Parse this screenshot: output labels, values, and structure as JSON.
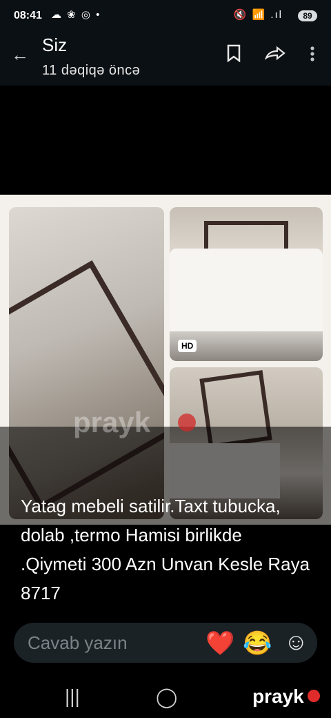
{
  "status_bar": {
    "time": "08:41",
    "left_icons": "☁ ❀ ◎ •",
    "right_icons": "🔇 📶 .ıl",
    "battery": "89"
  },
  "header": {
    "back_icon": "←",
    "title": "Siz",
    "subtitle": "11 dəqiqə öncə",
    "bookmark_icon": "⊡",
    "share_icon": "↪",
    "more_icon": "⋮"
  },
  "media": {
    "hd_badge_1": "HD",
    "hd_badge_2": "HD",
    "watermark": "prayk"
  },
  "caption": {
    "text": "Yatag mebeli satilir.Taxt tubucka, dolab ,termo Hamisi birlikde .Qiymeti 300 Azn Unvan Kesle Raya  8717"
  },
  "reply": {
    "placeholder": "Cavab yazın",
    "heart": "❤️",
    "laugh": "😂",
    "emoji_add": "☺"
  },
  "navbar": {
    "recents": "|||",
    "home": "◯",
    "logo": "prayk"
  },
  "colors": {
    "background": "#000000",
    "header": "#0b1014",
    "reply_field": "#1b2226",
    "logo_dot": "#e02b2b"
  }
}
